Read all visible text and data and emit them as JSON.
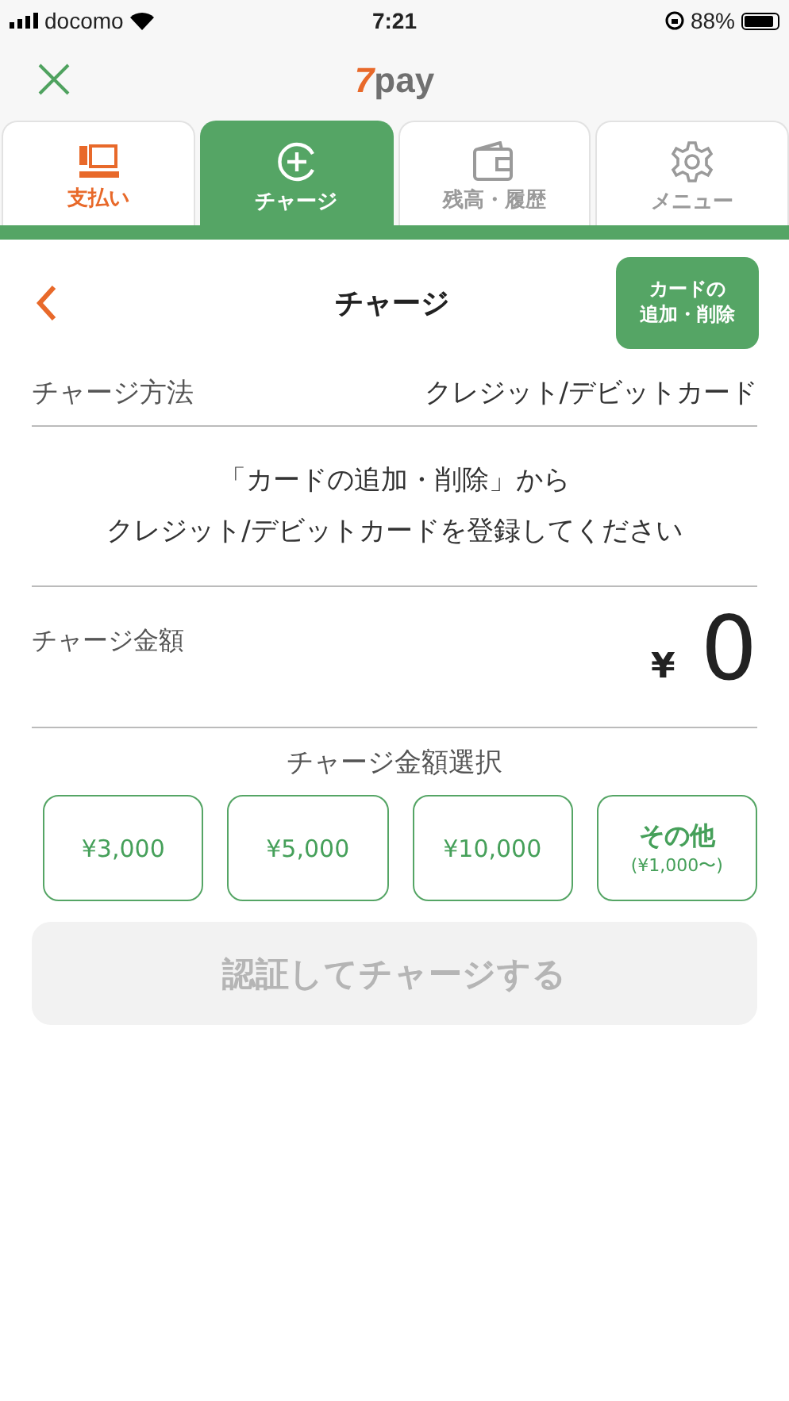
{
  "status_bar": {
    "carrier": "docomo",
    "time": "7:21",
    "battery": "88%"
  },
  "header": {
    "logo_mark": "7",
    "logo_text": "pay"
  },
  "tabs": [
    {
      "label": "支払い",
      "kind": "register",
      "selected": false,
      "color": "#e8692a"
    },
    {
      "label": "チャージ",
      "kind": "charge",
      "selected": true,
      "color": "#ffffff"
    },
    {
      "label": "残高・履歴",
      "kind": "wallet",
      "selected": false,
      "color": "#9a9a9a"
    },
    {
      "label": "メニュー",
      "kind": "gear",
      "selected": false,
      "color": "#9a9a9a"
    }
  ],
  "page_title": "チャージ",
  "card_button": [
    "カードの",
    "追加・削除"
  ],
  "method": {
    "label": "チャージ方法",
    "value": "クレジット/デビットカード"
  },
  "message": [
    "「カードの追加・削除」から",
    "クレジット/デビットカードを登録してください"
  ],
  "amount": {
    "label": "チャージ金額",
    "currency": "¥",
    "value": "0"
  },
  "amount_select": {
    "label": "チャージ金額選択",
    "options": [
      {
        "label": "¥3,000"
      },
      {
        "label": "¥5,000"
      },
      {
        "label": "¥10,000"
      },
      {
        "label": "その他",
        "sub": "(¥1,000〜)"
      }
    ]
  },
  "submit": {
    "label": "認証してチャージする",
    "disabled": true
  }
}
